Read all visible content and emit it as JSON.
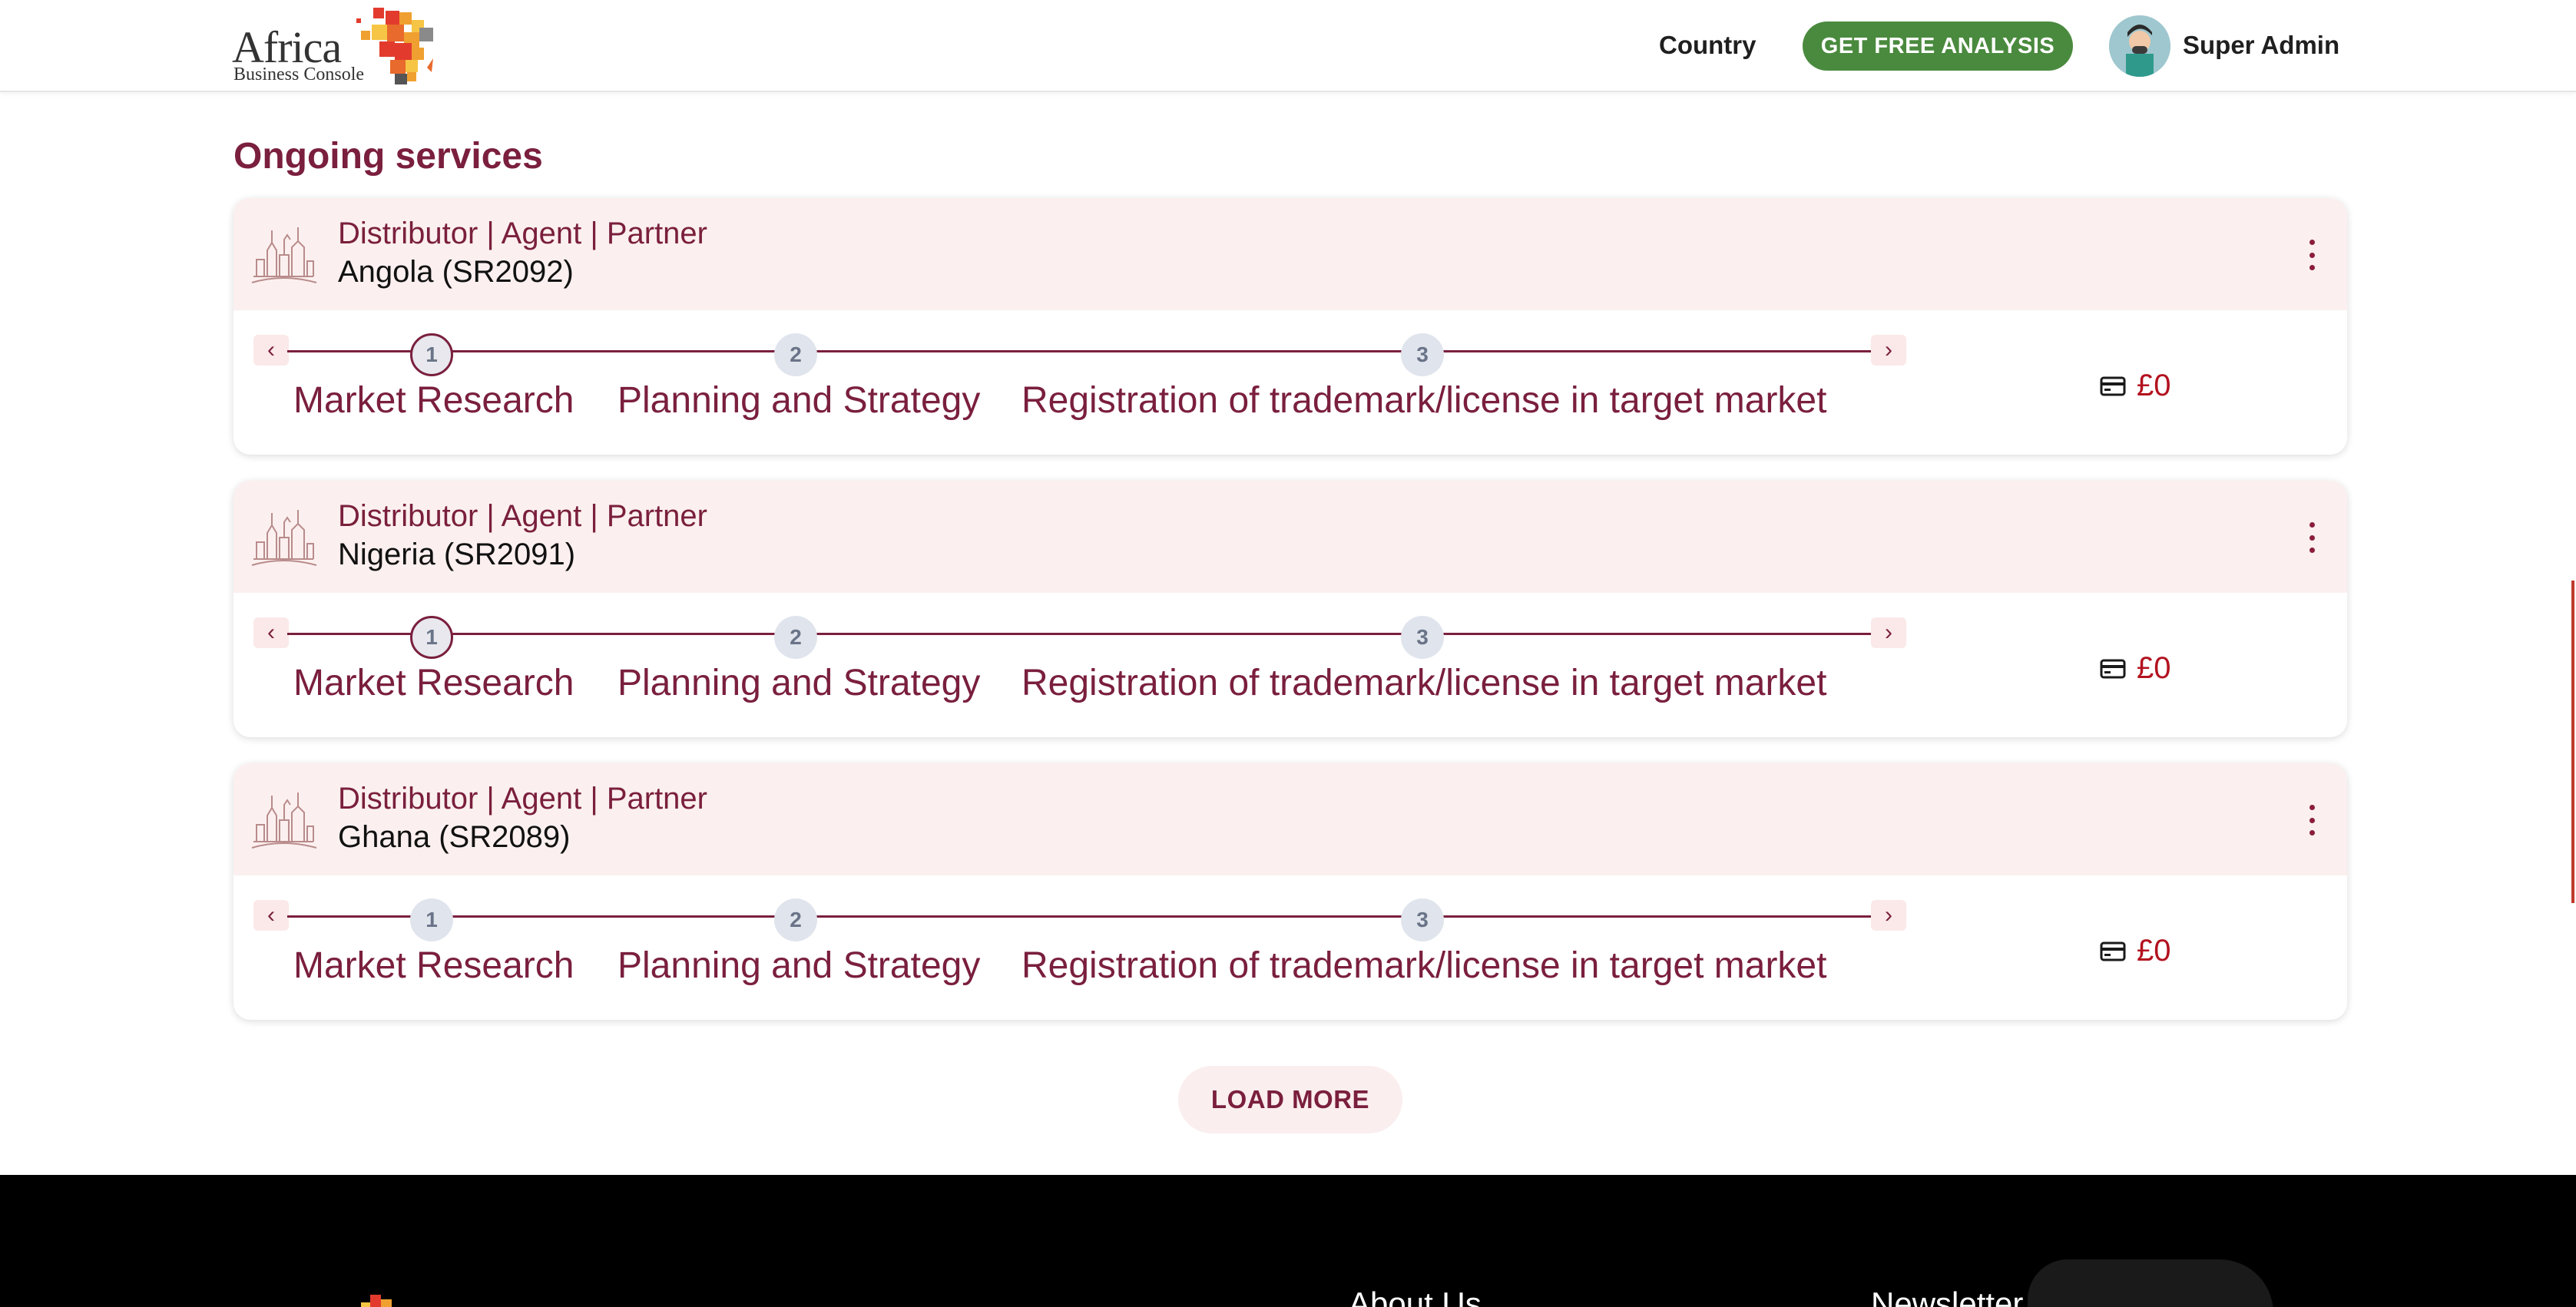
{
  "header": {
    "logo_line1": "Africa",
    "logo_line2": "Business Console",
    "nav_country": "Country",
    "cta_label": "GET FREE ANALYSIS",
    "user_name": "Super Admin"
  },
  "section_title": "Ongoing services",
  "services": [
    {
      "category": "Distributor | Agent | Partner",
      "country": "Angola (SR2092)",
      "active_step": 1,
      "steps": [
        {
          "number": "1",
          "label": "Market Research"
        },
        {
          "number": "2",
          "label": "Planning and Strategy"
        },
        {
          "number": "3",
          "label": "Registration of trademark/license in target market"
        }
      ],
      "price": "£0"
    },
    {
      "category": "Distributor | Agent | Partner",
      "country": "Nigeria (SR2091)",
      "active_step": 1,
      "steps": [
        {
          "number": "1",
          "label": "Market Research"
        },
        {
          "number": "2",
          "label": "Planning and Strategy"
        },
        {
          "number": "3",
          "label": "Registration of trademark/license in target market"
        }
      ],
      "price": "£0"
    },
    {
      "category": "Distributor | Agent | Partner",
      "country": "Ghana (SR2089)",
      "active_step": 0,
      "steps": [
        {
          "number": "1",
          "label": "Market Research"
        },
        {
          "number": "2",
          "label": "Planning and Strategy"
        },
        {
          "number": "3",
          "label": "Registration of trademark/license in target market"
        }
      ],
      "price": "£0"
    }
  ],
  "load_more_label": "LOAD MORE",
  "footer": {
    "about_label": "About Us",
    "newsletter_label": "Newsletter"
  },
  "colors": {
    "brand": "#7a1f3d",
    "cta": "#4a8a3e",
    "price": "#b3121f",
    "card_header": "#fbf0ef"
  },
  "icons": [
    "africa-logo-icon",
    "user-avatar-icon",
    "city-sketch-icon",
    "kebab-menu-icon",
    "chevron-left-icon",
    "chevron-right-icon",
    "credit-card-icon"
  ]
}
